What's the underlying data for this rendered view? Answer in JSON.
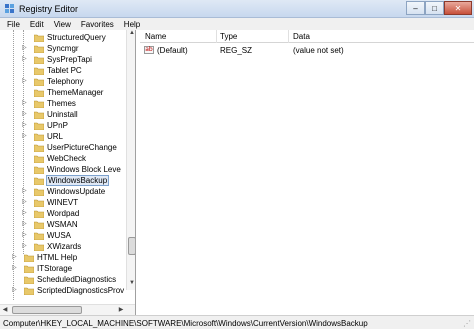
{
  "window": {
    "title": "Registry Editor",
    "minimize_glyph": "–",
    "maximize_glyph": "□",
    "close_glyph": "✕"
  },
  "menu": [
    "File",
    "Edit",
    "View",
    "Favorites",
    "Help"
  ],
  "tree": {
    "items": [
      {
        "label": "StructuredQuery",
        "expandable": false,
        "level": 2
      },
      {
        "label": "Syncmgr",
        "expandable": true,
        "level": 2
      },
      {
        "label": "SysPrepTapi",
        "expandable": true,
        "level": 2
      },
      {
        "label": "Tablet PC",
        "expandable": false,
        "level": 2
      },
      {
        "label": "Telephony",
        "expandable": true,
        "level": 2
      },
      {
        "label": "ThemeManager",
        "expandable": false,
        "level": 2
      },
      {
        "label": "Themes",
        "expandable": true,
        "level": 2
      },
      {
        "label": "Uninstall",
        "expandable": true,
        "level": 2
      },
      {
        "label": "UPnP",
        "expandable": true,
        "level": 2
      },
      {
        "label": "URL",
        "expandable": true,
        "level": 2
      },
      {
        "label": "UserPictureChange",
        "expandable": false,
        "level": 2
      },
      {
        "label": "WebCheck",
        "expandable": false,
        "level": 2
      },
      {
        "label": "Windows Block Leve",
        "expandable": false,
        "level": 2
      },
      {
        "label": "WindowsBackup",
        "expandable": false,
        "level": 2,
        "selected": true
      },
      {
        "label": "WindowsUpdate",
        "expandable": true,
        "level": 2
      },
      {
        "label": "WINEVT",
        "expandable": true,
        "level": 2
      },
      {
        "label": "Wordpad",
        "expandable": true,
        "level": 2
      },
      {
        "label": "WSMAN",
        "expandable": true,
        "level": 2
      },
      {
        "label": "WUSA",
        "expandable": true,
        "level": 2
      },
      {
        "label": "XWizards",
        "expandable": true,
        "level": 2
      },
      {
        "label": "HTML Help",
        "expandable": true,
        "level": 1
      },
      {
        "label": "ITStorage",
        "expandable": true,
        "level": 1
      },
      {
        "label": "ScheduledDiagnostics",
        "expandable": false,
        "level": 1
      },
      {
        "label": "ScriptedDiagnosticsProv",
        "expandable": true,
        "level": 1
      }
    ],
    "expand_glyph": "▷"
  },
  "scrollbar": {
    "up_glyph": "▲",
    "down_glyph": "▼",
    "left_glyph": "◀",
    "right_glyph": "▶"
  },
  "table": {
    "columns": [
      "Name",
      "Type",
      "Data"
    ],
    "rows": [
      {
        "icon": "ab",
        "name": "(Default)",
        "type": "REG_SZ",
        "data": "(value not set)"
      }
    ]
  },
  "status": {
    "path": "Computer\\HKEY_LOCAL_MACHINE\\SOFTWARE\\Microsoft\\Windows\\CurrentVersion\\WindowsBackup"
  },
  "colors": {
    "folder": "#e8c86a",
    "selection_border": "#7da2ce",
    "selection_bg": "#dfe8f5"
  }
}
